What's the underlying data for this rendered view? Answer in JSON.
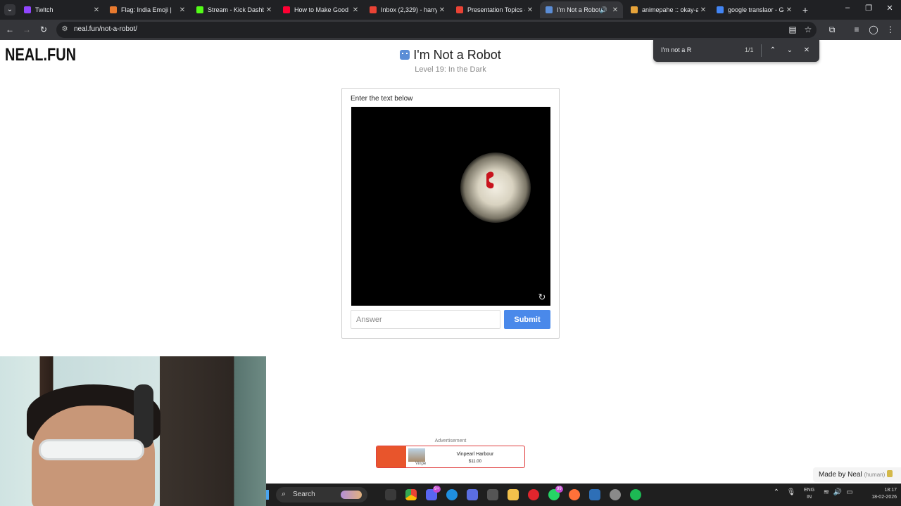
{
  "browser": {
    "tabs": [
      {
        "title": "Twitch",
        "favicon_color": "#9146ff",
        "active": false
      },
      {
        "title": "Flag: India Emoji |",
        "favicon_color": "#e87a2f",
        "active": false
      },
      {
        "title": "Stream - Kick Dashbo",
        "favicon_color": "#53fc18",
        "active": false
      },
      {
        "title": "How to Make Good I",
        "favicon_color": "#ff0033",
        "active": false
      },
      {
        "title": "Inbox (2,329) - harry",
        "favicon_color": "#ea4335",
        "active": false
      },
      {
        "title": "Presentation Topics -",
        "favicon_color": "#ea4335",
        "active": false
      },
      {
        "title": "I'm Not a Robot",
        "favicon_color": "#5b8dd6",
        "active": true
      },
      {
        "title": "animepahe :: okay-a",
        "favicon_color": "#e6a33a",
        "active": false
      },
      {
        "title": "google translaor - Go",
        "favicon_color": "#4285f4",
        "active": false
      }
    ],
    "url": "neal.fun/not-a-robot/",
    "icons": {
      "tab_search": "chevron-down-icon",
      "new_tab": "plus-icon",
      "back": "back-arrow-icon",
      "forward": "forward-arrow-icon",
      "reload": "reload-icon",
      "site_info": "site-info-icon",
      "reader": "reader-mode-icon",
      "bookmark": "star-icon",
      "extensions": "puzzle-icon",
      "media": "media-controls-icon",
      "profile": "profile-icon",
      "menu": "kebab-menu-icon"
    }
  },
  "find_bar": {
    "query": "I'm not a R",
    "count": "1/1"
  },
  "page": {
    "logo": "NEAL.FUN",
    "title": "I'm Not a Robot",
    "subtitle": "Level 19: In the Dark",
    "card": {
      "instruction": "Enter the text below",
      "answer_placeholder": "Answer",
      "submit_label": "Submit"
    },
    "ad": {
      "label": "Advertisement",
      "title": "Vinpearl Harbour",
      "price": "$11.00",
      "thumb_caption": "Vinpe"
    },
    "made_by": "Made by Neal",
    "made_by_note": "(human)"
  },
  "taskbar": {
    "search": "Search",
    "notification_badges": [
      "9+",
      "99"
    ],
    "language": [
      "ENG",
      "IN"
    ],
    "time": "18:17",
    "date": "18-02-2026"
  }
}
